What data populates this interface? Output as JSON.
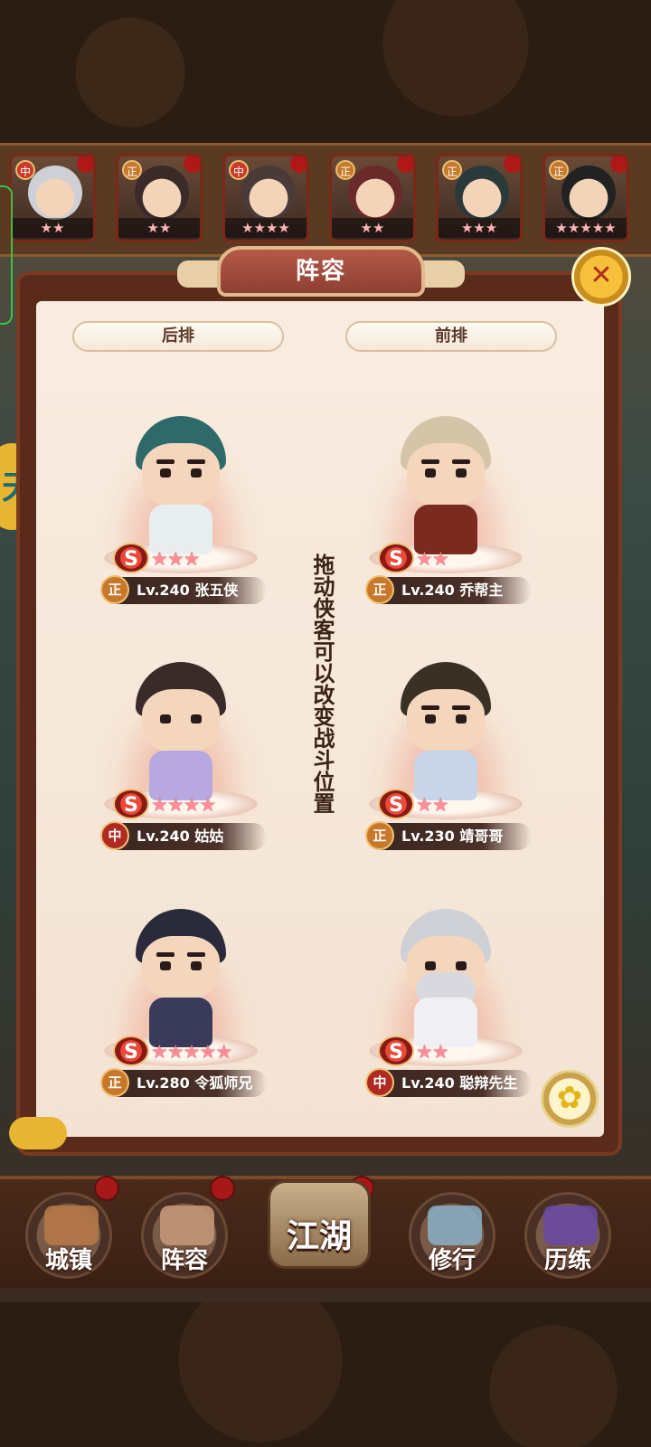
{
  "top_heroes": [
    {
      "rank": "中",
      "stars": "★★"
    },
    {
      "rank": "正",
      "stars": "★★"
    },
    {
      "rank": "中",
      "stars": "★★★★"
    },
    {
      "rank": "正",
      "stars": "★★"
    },
    {
      "rank": "正",
      "stars": "★★★"
    },
    {
      "rank": "正",
      "stars": "★★★★★"
    }
  ],
  "panel": {
    "title": "阵容",
    "back_row_label": "后排",
    "front_row_label": "前排",
    "instruction": "拖动侠客可以改变战斗位置"
  },
  "formation": [
    {
      "position": "back",
      "rank": "正",
      "level": "Lv.240",
      "name": "张五侠",
      "stars": "★★★",
      "grade": "S"
    },
    {
      "position": "front",
      "rank": "正",
      "level": "Lv.240",
      "name": "乔帮主",
      "stars": "★★",
      "grade": "S"
    },
    {
      "position": "back",
      "rank": "中",
      "level": "Lv.240",
      "name": "姑姑",
      "stars": "★★★★",
      "grade": "S"
    },
    {
      "position": "front",
      "rank": "正",
      "level": "Lv.230",
      "name": "靖哥哥",
      "stars": "★★",
      "grade": "S"
    },
    {
      "position": "back",
      "rank": "正",
      "level": "Lv.280",
      "name": "令狐师兄",
      "stars": "★★★★★",
      "grade": "S"
    },
    {
      "position": "front",
      "rank": "中",
      "level": "Lv.240",
      "name": "聪辩先生",
      "stars": "★★",
      "grade": "S"
    }
  ],
  "bottom_nav": {
    "town": "城镇",
    "lineup": "阵容",
    "jianghu": "江湖",
    "cultivate": "修行",
    "trial": "历练"
  },
  "side_badge": "天",
  "colors": {
    "panel_bg": "#f6e8da",
    "frame": "#5a2a1a",
    "rank_zheng": "#c8782a",
    "rank_zhong": "#b02a22",
    "accent_gold": "#f6c13a"
  }
}
